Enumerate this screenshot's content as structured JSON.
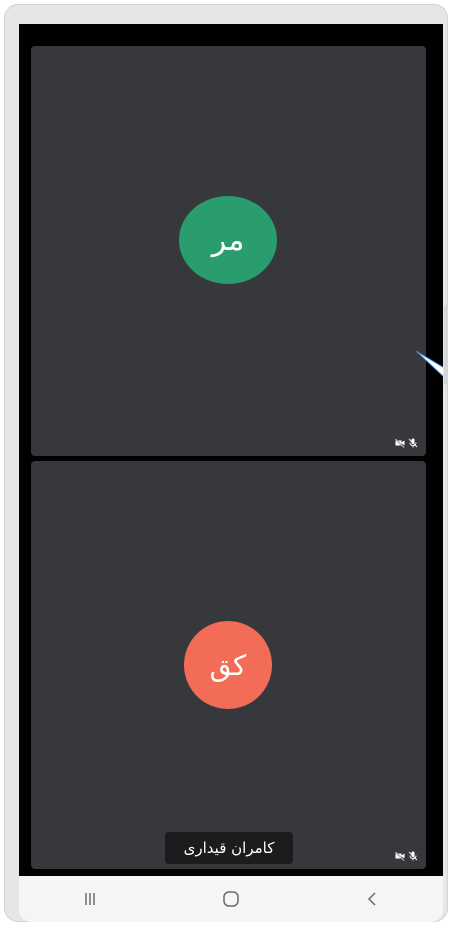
{
  "tiles": [
    {
      "avatar_initials": "مر",
      "avatar_color": "#2a9d6e",
      "status_icons": [
        "camera-off-icon",
        "mic-off-icon"
      ]
    },
    {
      "avatar_initials": "کق",
      "avatar_color": "#f26c57",
      "participant_name": "کامران قیداری",
      "status_icons": [
        "camera-off-icon",
        "mic-off-icon"
      ]
    }
  ],
  "navbar": {
    "buttons": [
      "recent-apps-icon",
      "home-icon",
      "back-icon"
    ]
  }
}
